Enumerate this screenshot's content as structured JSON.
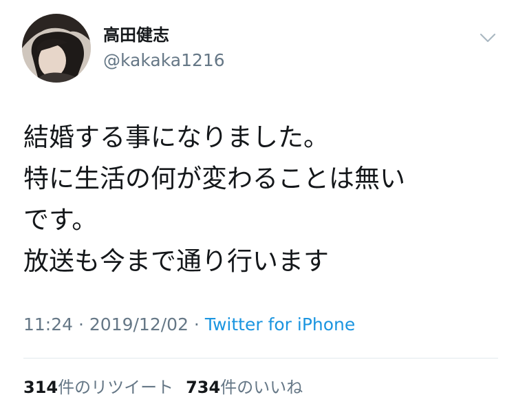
{
  "user": {
    "display_name": "高田健志",
    "handle": "@kakaka1216",
    "avatar_icon": "user-avatar"
  },
  "tweet": {
    "lines": [
      "結婚する事になりました。",
      "特に生活の何が変わることは無い",
      "です。",
      "放送も今まで通り行います"
    ]
  },
  "meta": {
    "time": "11:24",
    "separator": " · ",
    "date": "2019/12/02",
    "source": "Twitter for iPhone"
  },
  "stats": {
    "retweets_count": "314",
    "retweets_label": "件のリツイート",
    "likes_count": "734",
    "likes_label": "件のいいね"
  },
  "colors": {
    "text": "#14171a",
    "secondary": "#657786",
    "link": "#1b95e0",
    "divider": "#e1e8ed"
  },
  "icons": {
    "menu": "chevron-down-icon"
  }
}
